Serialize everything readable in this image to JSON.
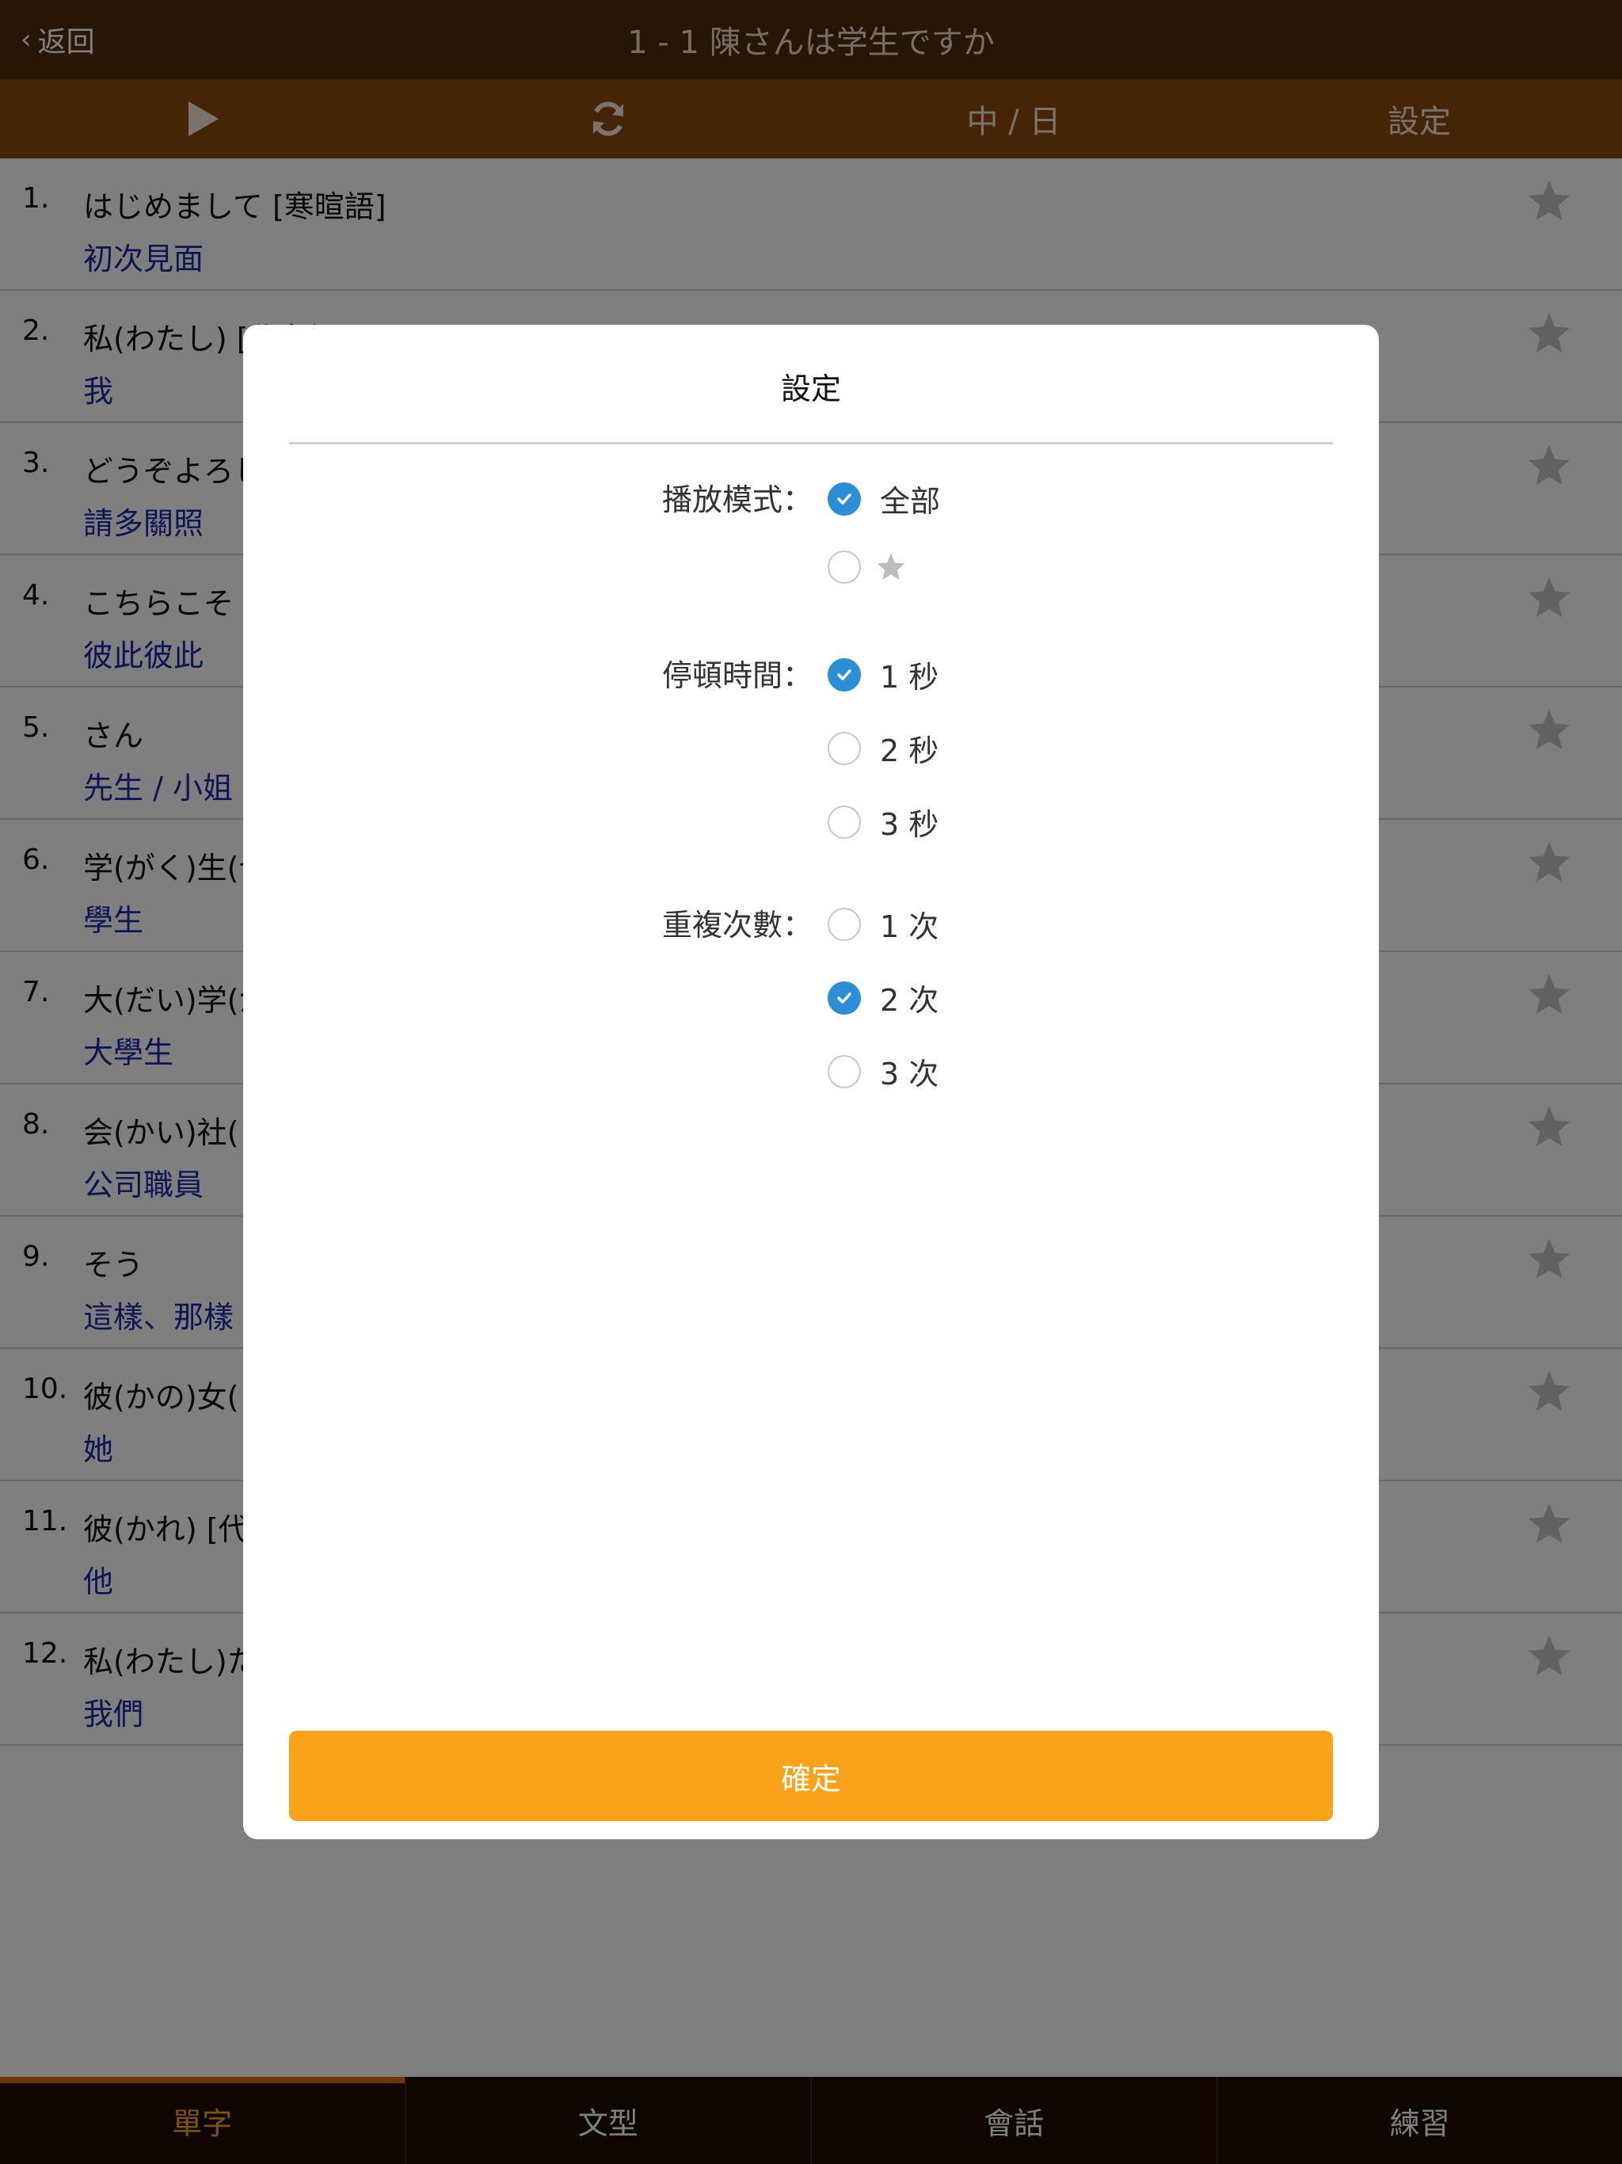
{
  "navbar": {
    "back_label": "返回",
    "title": "1 - 1 陳さんは学生ですか"
  },
  "toolbar": {
    "language_toggle": "中 / 日",
    "settings_label": "設定"
  },
  "words": [
    {
      "num": "1.",
      "jp": "はじめまして  [寒暄語]",
      "zh": "初次見面"
    },
    {
      "num": "2.",
      "jp": "私(わたし)  [代名詞]",
      "zh": "我"
    },
    {
      "num": "3.",
      "jp": "どうぞよろし",
      "zh": "請多關照"
    },
    {
      "num": "4.",
      "jp": "こちらこそ",
      "zh": "彼此彼此"
    },
    {
      "num": "5.",
      "jp": "さん",
      "zh": "先生 / 小姐"
    },
    {
      "num": "6.",
      "jp": "学(がく)生(せ",
      "zh": "學生"
    },
    {
      "num": "7.",
      "jp": "大(だい)学(が",
      "zh": "大學生"
    },
    {
      "num": "8.",
      "jp": "会(かい)社(し",
      "zh": "公司職員"
    },
    {
      "num": "9.",
      "jp": "そう",
      "zh": "這樣、那樣"
    },
    {
      "num": "10.",
      "jp": "彼(かの)女(じ",
      "zh": "她"
    },
    {
      "num": "11.",
      "jp": "彼(かれ)  [代",
      "zh": "他"
    },
    {
      "num": "12.",
      "jp": "私(わたし)た",
      "zh": "我們"
    }
  ],
  "tabs": [
    {
      "label": "單字",
      "active": true
    },
    {
      "label": "文型",
      "active": false
    },
    {
      "label": "會話",
      "active": false
    },
    {
      "label": "練習",
      "active": false
    }
  ],
  "modal": {
    "title": "設定",
    "play_mode": {
      "label": "播放模式：",
      "options": [
        {
          "label": "全部",
          "checked": true
        },
        {
          "label": "",
          "icon": "star-icon",
          "checked": false
        }
      ]
    },
    "pause_time": {
      "label": "停頓時間：",
      "options": [
        {
          "label": "1 秒",
          "checked": true
        },
        {
          "label": "2 秒",
          "checked": false
        },
        {
          "label": "3 秒",
          "checked": false
        }
      ]
    },
    "repeat_count": {
      "label": "重複次數：",
      "options": [
        {
          "label": "1 次",
          "checked": false
        },
        {
          "label": "2 次",
          "checked": true
        },
        {
          "label": "3 次",
          "checked": false
        }
      ]
    },
    "confirm_label": "確定"
  },
  "colors": {
    "navbar_bg": "#502b08",
    "toolbar_bg": "#8b4a0d",
    "active_tab": "#f6a623",
    "radio_checked": "#2c8fd6",
    "confirm_bg": "#f9a21a",
    "translation_text": "#1a2aa8"
  }
}
